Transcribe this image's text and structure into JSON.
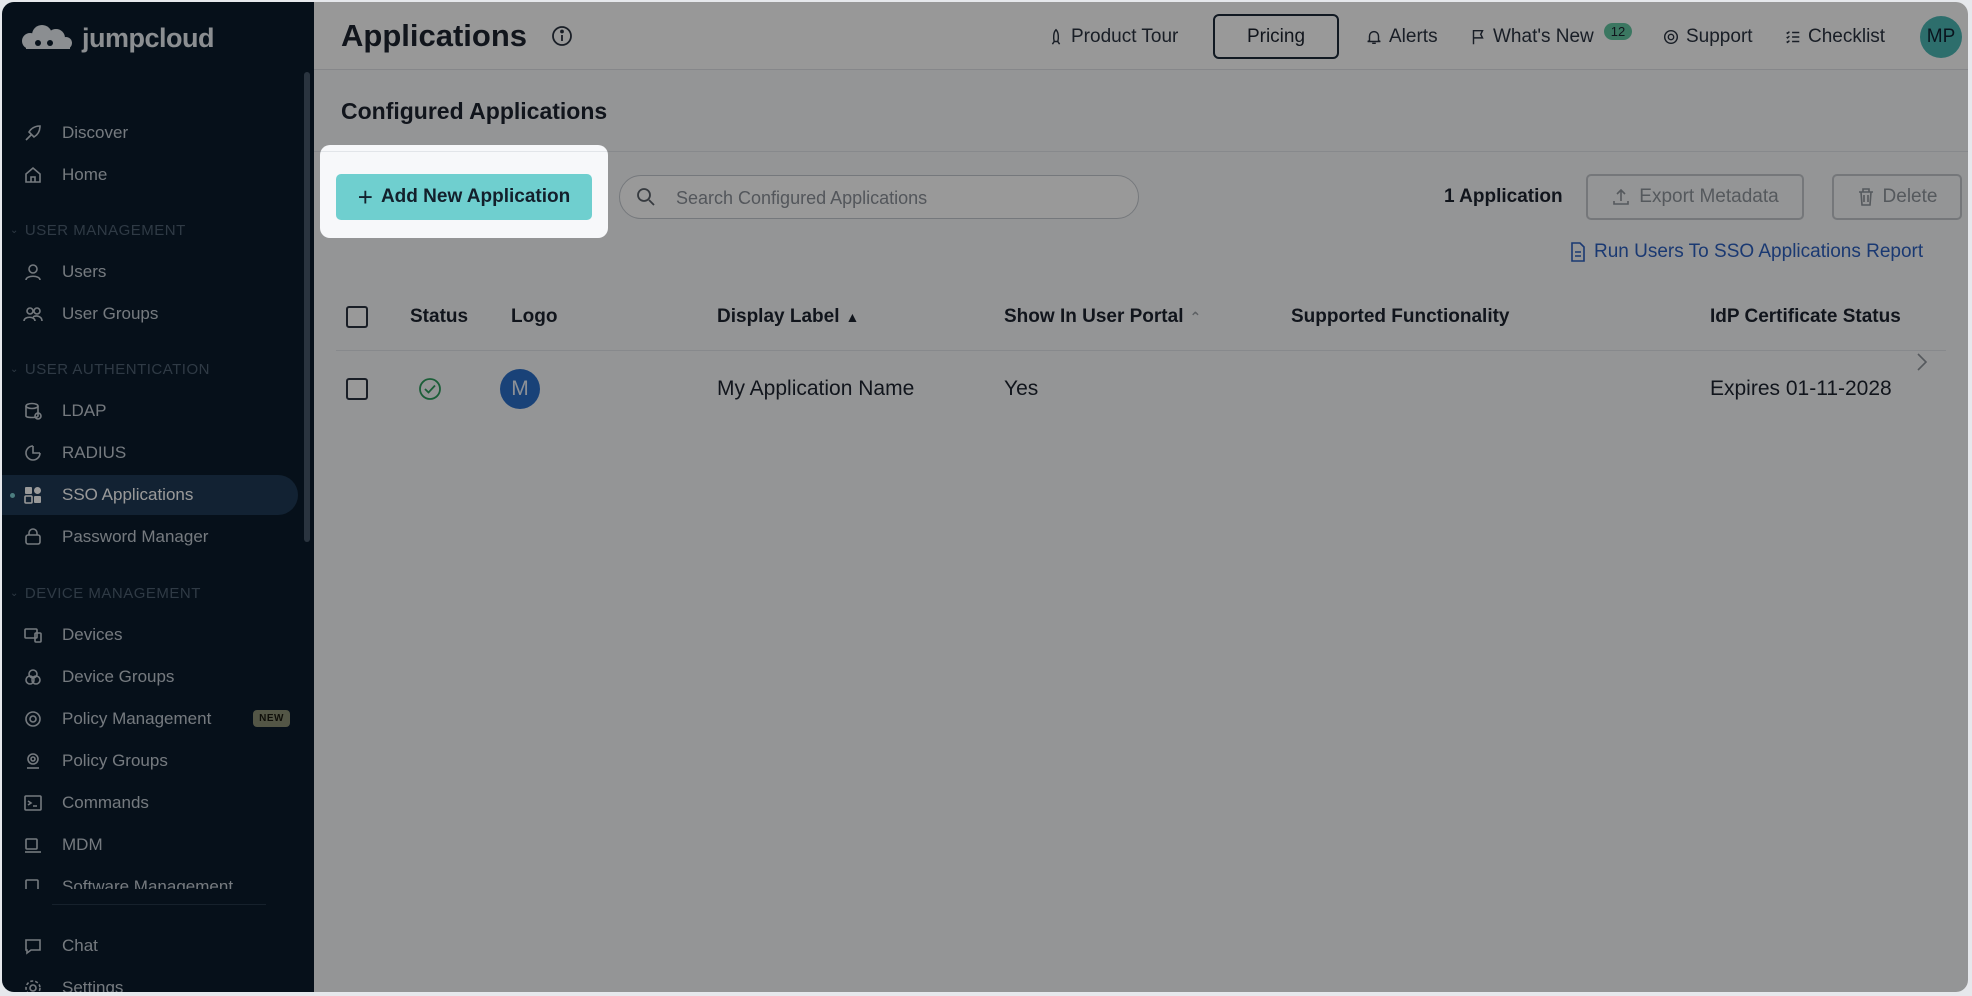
{
  "sidebar": {
    "brand": "jumpcloud",
    "items_top": [
      {
        "label": "Discover",
        "icon": "rocket-icon"
      },
      {
        "label": "Home",
        "icon": "home-icon"
      }
    ],
    "sections": [
      {
        "title": "USER MANAGEMENT",
        "items": [
          {
            "label": "Users"
          },
          {
            "label": "User Groups"
          }
        ]
      },
      {
        "title": "USER AUTHENTICATION",
        "items": [
          {
            "label": "LDAP"
          },
          {
            "label": "RADIUS"
          },
          {
            "label": "SSO Applications"
          },
          {
            "label": "Password Manager"
          }
        ]
      },
      {
        "title": "DEVICE MANAGEMENT",
        "items": [
          {
            "label": "Devices"
          },
          {
            "label": "Device Groups"
          },
          {
            "label": "Policy Management",
            "badge": "NEW"
          },
          {
            "label": "Policy Groups"
          },
          {
            "label": "Commands"
          },
          {
            "label": "MDM"
          },
          {
            "label": "Software Management"
          }
        ]
      }
    ],
    "bottom": [
      {
        "label": "Chat"
      },
      {
        "label": "Settings"
      }
    ]
  },
  "header": {
    "title": "Applications",
    "product_tour": "Product Tour",
    "pricing": "Pricing",
    "alerts": "Alerts",
    "whats_new": "What's New",
    "whats_new_count": "12",
    "support": "Support",
    "checklist": "Checklist",
    "avatar": "MP"
  },
  "main": {
    "section_title": "Configured Applications",
    "add_button": "Add New Application",
    "search_placeholder": "Search Configured Applications",
    "app_count": "1 Application",
    "export_button": "Export Metadata",
    "delete_button": "Delete",
    "report_link": "Run Users To SSO Applications Report",
    "columns": [
      "Status",
      "Logo",
      "Display Label",
      "Show In User Portal",
      "Supported Functionality",
      "IdP Certificate Status"
    ],
    "rows": [
      {
        "logo_letter": "M",
        "display_label": "My Application Name",
        "show_in_portal": "Yes",
        "supported_functionality": "",
        "cert_status": "Expires 01-11-2028"
      }
    ]
  },
  "colors": {
    "sidebar_bg": "#0b1c2c",
    "accent": "#6fcfcf",
    "overlay": "rgba(0,0,0,0.4)"
  }
}
